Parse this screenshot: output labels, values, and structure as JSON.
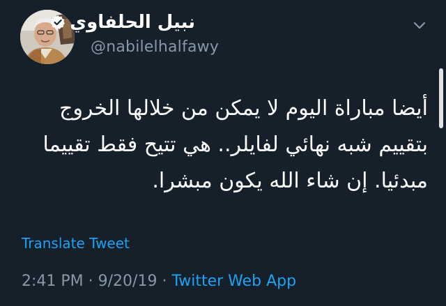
{
  "user": {
    "display_name": "نبيل الحلفاوي",
    "handle": "@nabilelhalfawy",
    "avatar_icon": "profile-photo",
    "verified_icon": "verified-badge-icon"
  },
  "tweet": {
    "lines": [
      "أيضا مباراة اليوم لا يمكن من خلالها الخروج",
      "بتقييم شبه نهائي لفايلر.. هي تتيح فقط تقييما",
      "مبدئيا. إن شاء الله يكون مبشرا."
    ]
  },
  "translate_label": "Translate Tweet",
  "meta": {
    "time": "2:41 PM",
    "separator": " · ",
    "date": "9/20/19",
    "source": "Twitter Web App"
  },
  "colors": {
    "background": "#15202b",
    "accent": "#1da1f2",
    "secondary_text": "#8899a6"
  }
}
